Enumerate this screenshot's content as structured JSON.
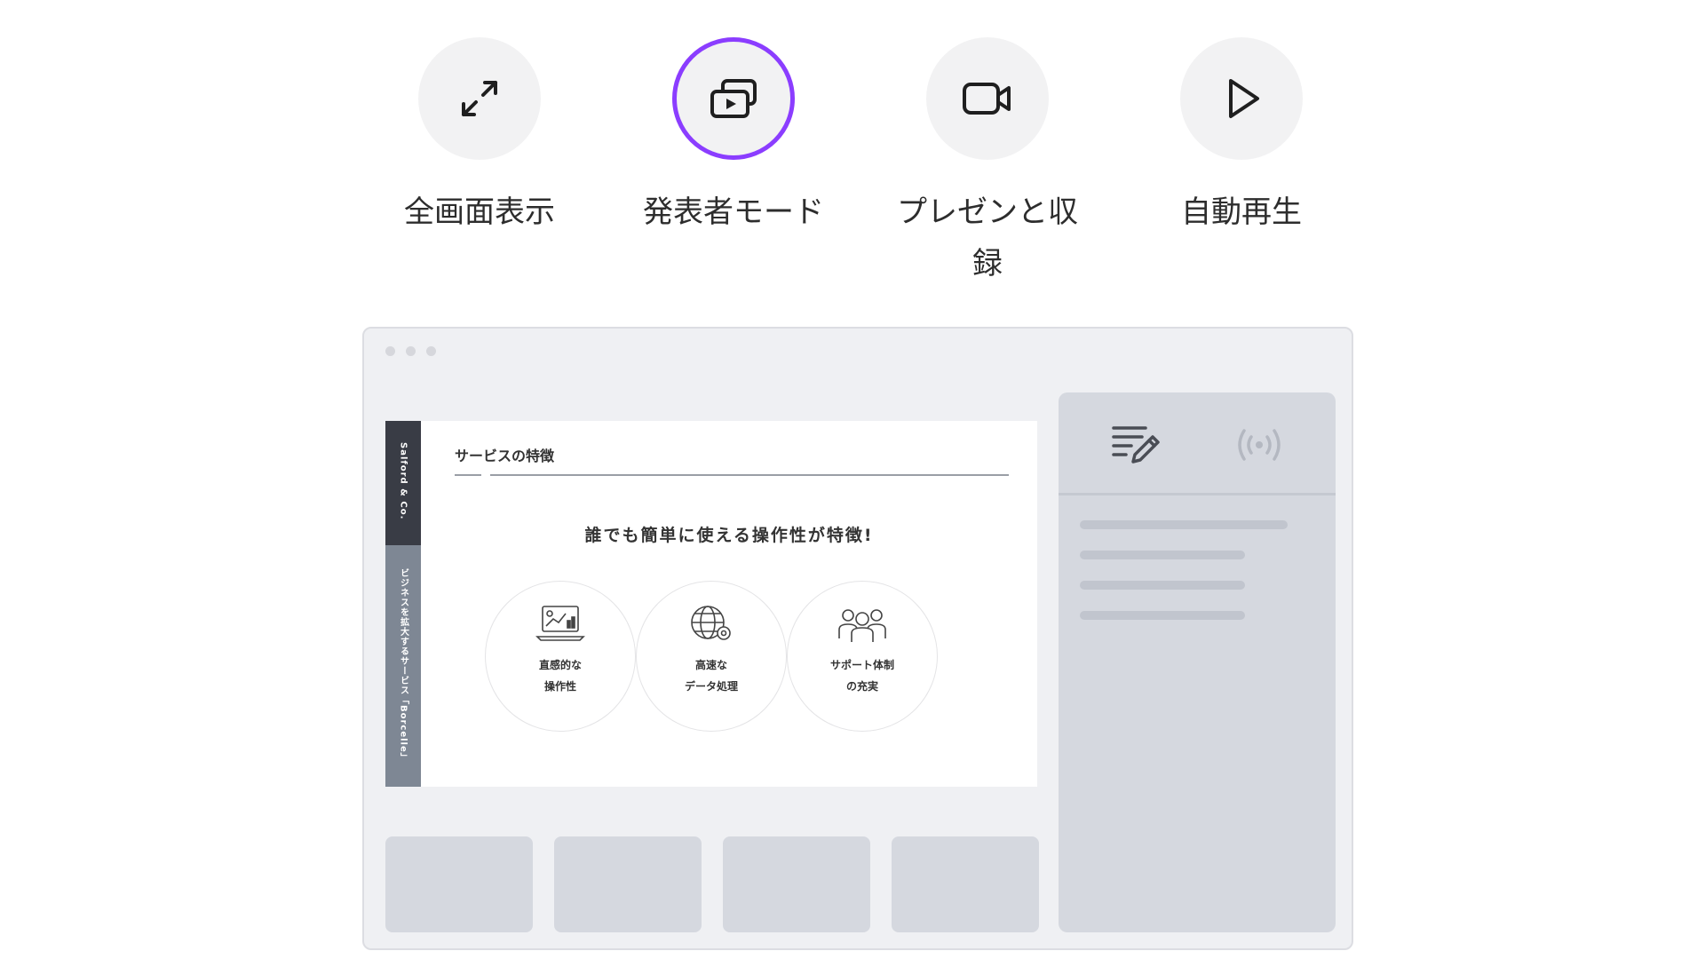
{
  "modes": [
    {
      "key": "fullscreen",
      "label": "全画面表示",
      "icon": "expand-arrows-icon",
      "active": false
    },
    {
      "key": "presenter",
      "label": "発表者モード",
      "icon": "presenter-screen-icon",
      "active": true
    },
    {
      "key": "record",
      "label": "プレゼンと収録",
      "icon": "video-camera-icon",
      "active": false
    },
    {
      "key": "autoplay",
      "label": "自動再生",
      "icon": "play-icon",
      "active": false
    }
  ],
  "colors": {
    "accent": "#8b3dff",
    "circle_bg": "#f2f2f3",
    "window_bg": "#eff0f3",
    "panel_bg": "#d5d8df"
  },
  "slide": {
    "brand": "Salford & Co.",
    "tagline": "ビジネスを拡大するサービス「Borcelle」",
    "title": "サービスの特徴",
    "heading": "誰でも簡単に使える操作性が特徴!",
    "features": [
      {
        "text": "直感的な\n操作性",
        "icon": "laptop-chart-icon"
      },
      {
        "text": "高速な\nデータ処理",
        "icon": "globe-gear-icon"
      },
      {
        "text": "サポート体制\nの充実",
        "icon": "support-team-icon"
      }
    ]
  },
  "panel": {
    "icons": [
      "notes-edit-icon",
      "broadcast-icon"
    ]
  }
}
